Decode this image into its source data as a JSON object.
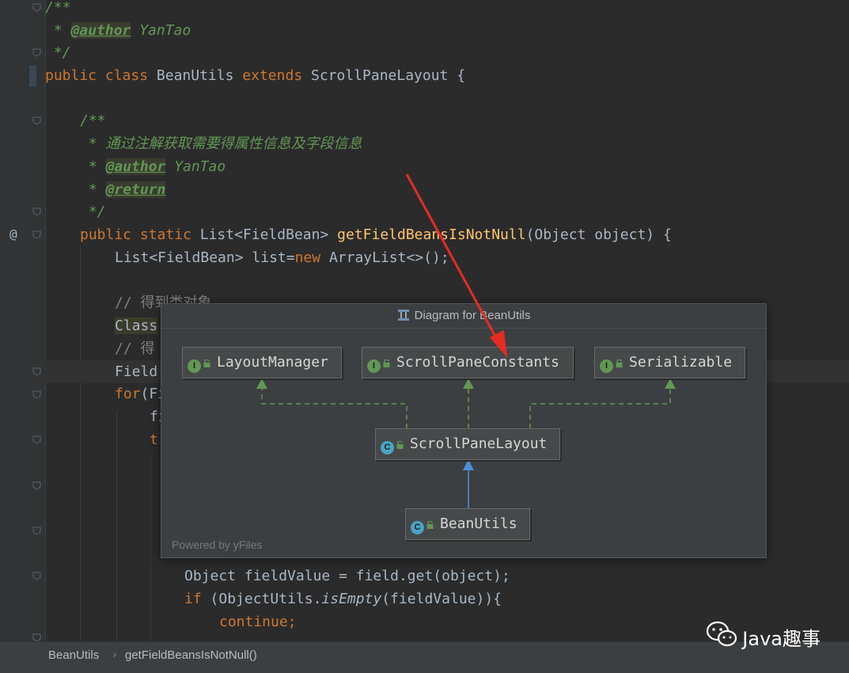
{
  "editor": {
    "lines": {
      "l1_doc_open": "/**",
      "l2_star": " * ",
      "l2_tag": "@author",
      "l2_value": " YanTao",
      "l3_doc_close": " */",
      "l4_kw_public": "public",
      "l4_kw_class": "class",
      "l4_name": "BeanUtils",
      "l4_kw_extends": "extends",
      "l4_parent": "ScrollPaneLayout {",
      "l6_doc_open": "/**",
      "l7_text": " * 通过注解获取需要得属性信息及字段信息",
      "l8_star": " * ",
      "l8_tag": "@author",
      "l8_value": " YanTao",
      "l9_star": " * ",
      "l9_tag": "@return",
      "l10_doc_close": " */",
      "l11_kw": "public static",
      "l11_type": "List<FieldBean>",
      "l11_method": "getFieldBeansIsNotNull",
      "l11_params": "(Object object) {",
      "l12_a": "List<FieldBean> list=",
      "l12_kw": "new",
      "l12_b": "ArrayList<>();",
      "l14_comment": "// 得到类对象",
      "l15_text": "Class",
      "l16_comment": "// 得",
      "l17_text": "Field",
      "l18_kw": "for",
      "l18_text": "(Fi",
      "l19_text": "fi",
      "l20_kw": "tr",
      "l24_a": "Object",
      "l24_b": "fieldValue = field.get(object);",
      "l25_kw": "if",
      "l25_a": "(ObjectUtils.",
      "l25_it": "isEmpty",
      "l25_b": "(fieldValue)){",
      "l26_kw": "continue;"
    },
    "gutter_annotation": "@"
  },
  "popup": {
    "title": "Diagram for BeanUtils",
    "nodes": {
      "layout_manager": {
        "badge": "I",
        "label": "LayoutManager"
      },
      "scroll_pane_constants": {
        "badge": "I",
        "label": "ScrollPaneConstants"
      },
      "serializable": {
        "badge": "I",
        "label": "Serializable"
      },
      "scroll_pane_layout": {
        "badge": "C",
        "label": "ScrollPaneLayout"
      },
      "bean_utils": {
        "badge": "C",
        "label": "BeanUtils"
      }
    },
    "powered_by": "Powered by yFiles",
    "colors": {
      "interface_edge": "#629755",
      "extends_edge": "#4a90d9",
      "interface_badge": "#629755",
      "class_badge": "#4aa3c2"
    }
  },
  "annotation_arrow_color": "#e52b22",
  "breadcrumb": {
    "class": "BeanUtils",
    "separator": "›",
    "method": "getFieldBeansIsNotNull()"
  },
  "watermark": {
    "icon": "wechat-icon",
    "text": "Java趣事"
  }
}
